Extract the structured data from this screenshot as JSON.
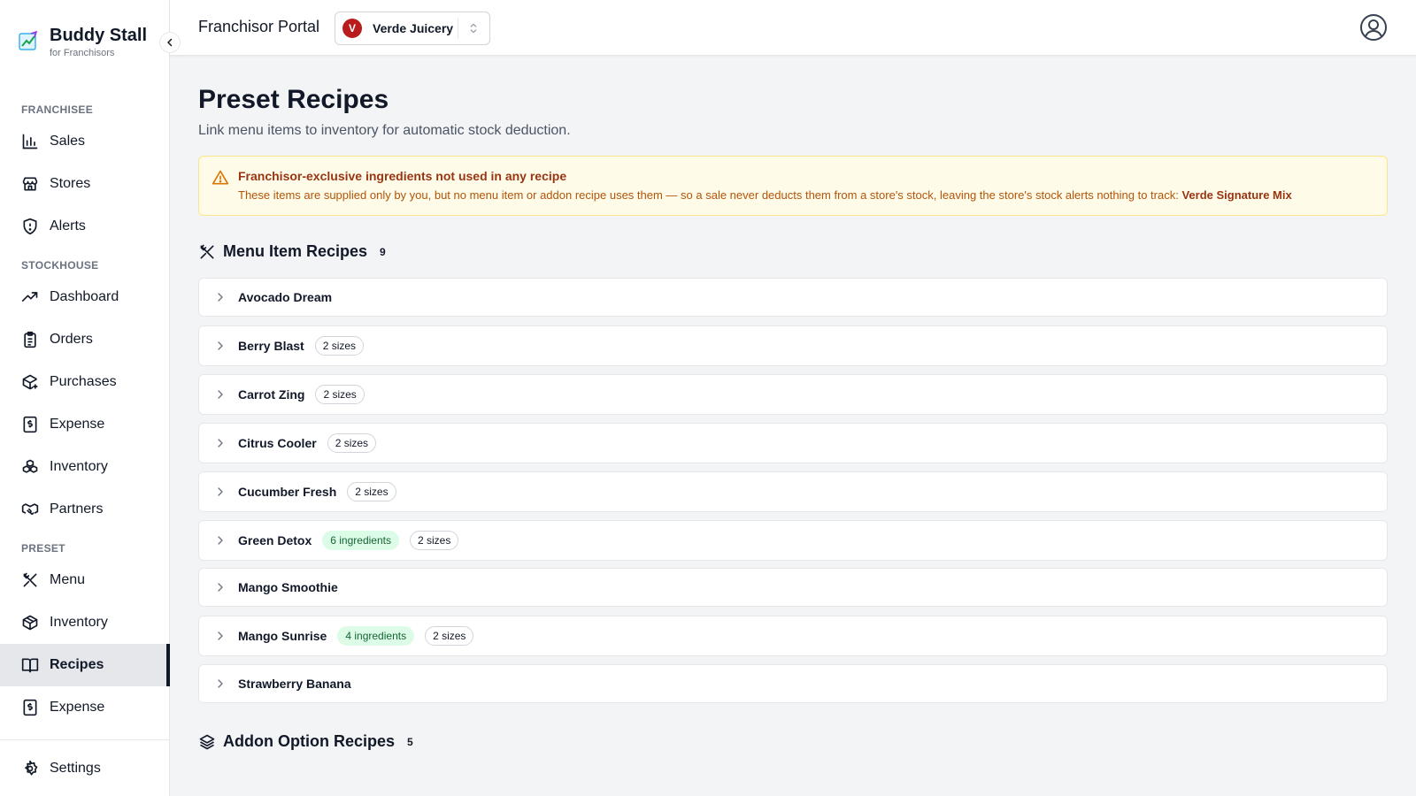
{
  "brand": {
    "name": "Buddy Stall",
    "subtitle": "for Franchisors"
  },
  "sidebar": {
    "sections": [
      {
        "label": "FRANCHISEE",
        "items": [
          {
            "label": "Sales",
            "icon": "bar-chart-icon"
          },
          {
            "label": "Stores",
            "icon": "store-icon"
          },
          {
            "label": "Alerts",
            "icon": "shield-icon"
          }
        ]
      },
      {
        "label": "STOCKHOUSE",
        "items": [
          {
            "label": "Dashboard",
            "icon": "trending-up-icon"
          },
          {
            "label": "Orders",
            "icon": "clipboard-icon"
          },
          {
            "label": "Purchases",
            "icon": "package-plus-icon"
          },
          {
            "label": "Expense",
            "icon": "receipt-icon"
          },
          {
            "label": "Inventory",
            "icon": "boxes-icon"
          },
          {
            "label": "Partners",
            "icon": "handshake-icon"
          }
        ]
      },
      {
        "label": "PRESET",
        "items": [
          {
            "label": "Menu",
            "icon": "utensils-icon"
          },
          {
            "label": "Inventory",
            "icon": "package-icon"
          },
          {
            "label": "Recipes",
            "icon": "book-open-icon",
            "active": true
          },
          {
            "label": "Expense",
            "icon": "receipt-icon"
          }
        ]
      }
    ],
    "settings_label": "Settings"
  },
  "header": {
    "portal_title": "Franchisor Portal",
    "store": {
      "initial": "V",
      "name": "Verde Juicery",
      "avatar_color": "#b91c1c"
    }
  },
  "page": {
    "title": "Preset Recipes",
    "subtitle": "Link menu items to inventory for automatic stock deduction."
  },
  "warning": {
    "title": "Franchisor-exclusive ingredients not used in any recipe",
    "body": "These items are supplied only by you, but no menu item or addon recipe uses them — so a sale never deducts them from a store's stock, leaving the store's stock alerts nothing to track: ",
    "highlight": "Verde Signature Mix"
  },
  "menu_recipes": {
    "title": "Menu Item Recipes",
    "count": "9",
    "items": [
      {
        "name": "Avocado Dream",
        "ingredients": "",
        "sizes": ""
      },
      {
        "name": "Berry Blast",
        "ingredients": "",
        "sizes": "2 sizes"
      },
      {
        "name": "Carrot Zing",
        "ingredients": "",
        "sizes": "2 sizes"
      },
      {
        "name": "Citrus Cooler",
        "ingredients": "",
        "sizes": "2 sizes"
      },
      {
        "name": "Cucumber Fresh",
        "ingredients": "",
        "sizes": "2 sizes"
      },
      {
        "name": "Green Detox",
        "ingredients": "6 ingredients",
        "sizes": "2 sizes"
      },
      {
        "name": "Mango Smoothie",
        "ingredients": "",
        "sizes": ""
      },
      {
        "name": "Mango Sunrise",
        "ingredients": "4 ingredients",
        "sizes": "2 sizes"
      },
      {
        "name": "Strawberry Banana",
        "ingredients": "",
        "sizes": ""
      }
    ]
  },
  "addon_recipes": {
    "title": "Addon Option Recipes",
    "count": "5"
  },
  "colors": {
    "accent": "#111827",
    "warning_bg": "#fefce8",
    "warning_text": "#b45309",
    "green_pill": "#dcfce7"
  }
}
